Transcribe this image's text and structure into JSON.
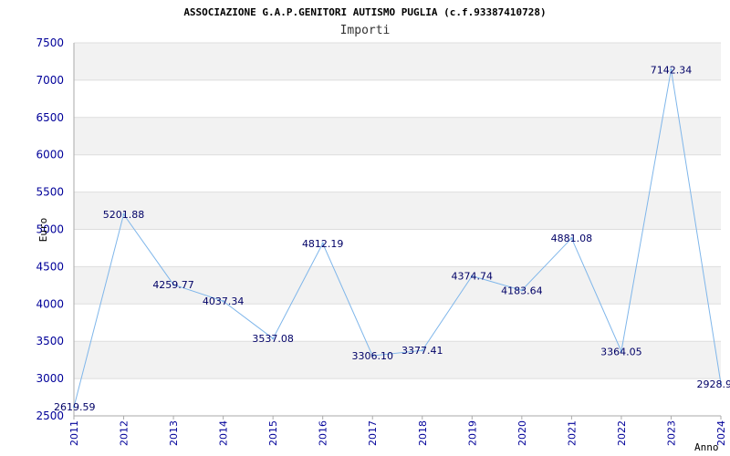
{
  "chart_data": {
    "type": "line",
    "title": "ASSOCIAZIONE G.A.P.GENITORI AUTISMO PUGLIA (c.f.93387410728)",
    "subtitle": "Importi",
    "xlabel": "Anno",
    "ylabel": "Euro",
    "x": [
      "2011",
      "2012",
      "2013",
      "2014",
      "2015",
      "2016",
      "2017",
      "2018",
      "2019",
      "2020",
      "2021",
      "2022",
      "2023",
      "2024"
    ],
    "values": [
      2619.59,
      5201.88,
      4259.77,
      4037.34,
      3537.08,
      4812.19,
      3306.1,
      3377.41,
      4374.74,
      4183.64,
      4881.08,
      3364.05,
      7142.34,
      2928.9
    ],
    "labels": [
      "2619.59",
      "5201.88",
      "4259.77",
      "4037.34",
      "3537.08",
      "4812.19",
      "3306.10",
      "3377.41",
      "4374.74",
      "4183.64",
      "4881.08",
      "3364.05",
      "7142.34",
      "2928.9"
    ],
    "ylim": [
      2500,
      7500
    ],
    "yticks": [
      2500,
      3000,
      3500,
      4000,
      4500,
      5000,
      5500,
      6000,
      6500,
      7000,
      7500
    ],
    "grid": true,
    "colors": {
      "line": "#7fb6ea",
      "band": "#f2f2f2",
      "tick": "#000099"
    }
  }
}
